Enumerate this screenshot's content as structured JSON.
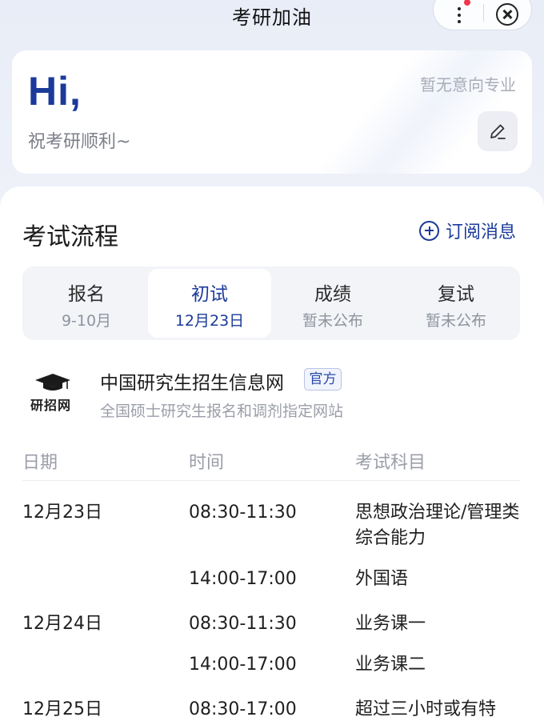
{
  "header": {
    "title": "考研加油"
  },
  "greeting": {
    "hi": "Hi,",
    "wish": "祝考研顺利~",
    "major": "暂无意向专业"
  },
  "process": {
    "title": "考试流程",
    "subscribe_label": "订阅消息",
    "tabs": [
      {
        "label": "报名",
        "sub": "9-10月"
      },
      {
        "label": "初试",
        "sub": "12月23日"
      },
      {
        "label": "成绩",
        "sub": "暂未公布"
      },
      {
        "label": "复试",
        "sub": "暂未公布"
      }
    ],
    "active_tab": 1
  },
  "source": {
    "logo_text": "研招网",
    "name": "中国研究生招生信息网",
    "badge": "官方",
    "description": "全国硕士研究生报名和调剂指定网站"
  },
  "schedule": {
    "headers": {
      "date": "日期",
      "time": "时间",
      "subject": "考试科目"
    },
    "rows": [
      {
        "date": "12月23日",
        "time": "08:30-11:30",
        "subject": "思想政治理论/管理类综合能力"
      },
      {
        "date": "",
        "time": "14:00-17:00",
        "subject": "外国语"
      },
      {
        "date": "12月24日",
        "time": "08:30-11:30",
        "subject": "业务课一"
      },
      {
        "date": "",
        "time": "14:00-17:00",
        "subject": "业务课二"
      },
      {
        "date": "12月25日",
        "time": "08:30-17:00",
        "subject": "超过三小时或有特"
      }
    ]
  },
  "colors": {
    "accent": "#1b3a9a",
    "notification": "#f0364b"
  }
}
